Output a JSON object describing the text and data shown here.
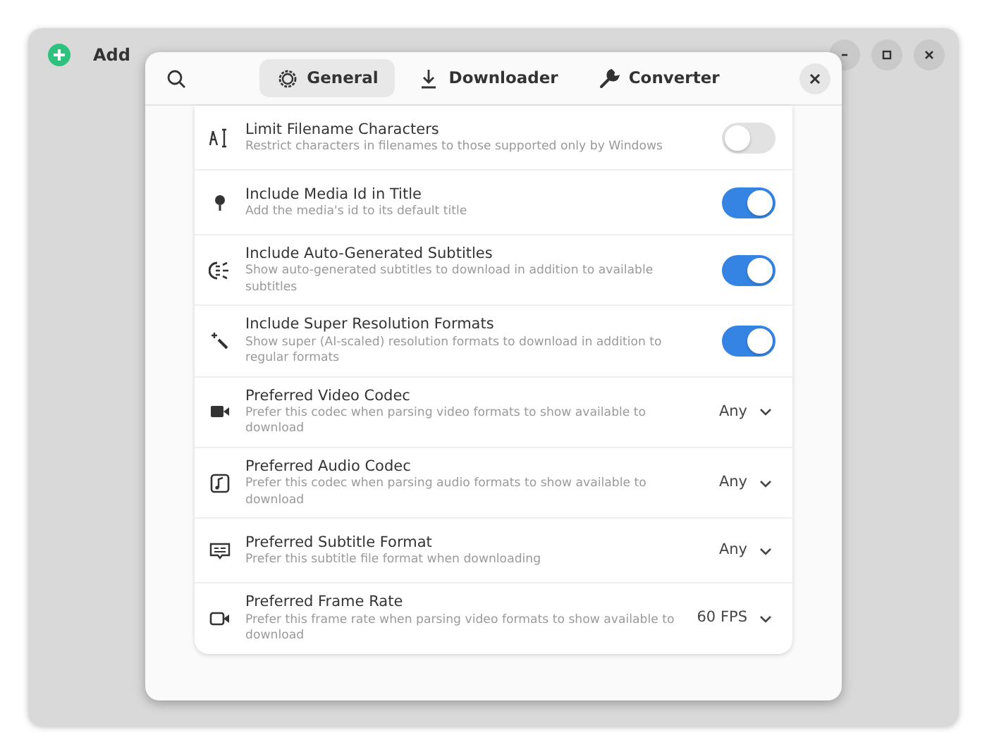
{
  "main_window": {
    "add_button": "Add"
  },
  "dialog": {
    "tabs": [
      {
        "label": "General",
        "selected": true
      },
      {
        "label": "Downloader",
        "selected": false
      },
      {
        "label": "Converter",
        "selected": false
      }
    ],
    "rows": [
      {
        "kind": "switch",
        "title": "Limit Filename Characters",
        "subtitle": "Restrict characters in filenames to those supported only by Windows",
        "on": false
      },
      {
        "kind": "switch",
        "title": "Include Media Id in Title",
        "subtitle": "Add the media's id to its default title",
        "on": true
      },
      {
        "kind": "switch",
        "title": "Include Auto-Generated Subtitles",
        "subtitle": "Show auto-generated subtitles to download in addition to available subtitles",
        "on": true
      },
      {
        "kind": "switch",
        "title": "Include Super Resolution Formats",
        "subtitle": "Show super (AI-scaled) resolution formats to download in addition to regular formats",
        "on": true
      },
      {
        "kind": "dropdown",
        "title": "Preferred Video Codec",
        "subtitle": "Prefer this codec when parsing video formats to show available to download",
        "value": "Any"
      },
      {
        "kind": "dropdown",
        "title": "Preferred Audio Codec",
        "subtitle": "Prefer this codec when parsing audio formats to show available to download",
        "value": "Any"
      },
      {
        "kind": "dropdown",
        "title": "Preferred Subtitle Format",
        "subtitle": "Prefer this subtitle file format when downloading",
        "value": "Any"
      },
      {
        "kind": "dropdown",
        "title": "Preferred Frame Rate",
        "subtitle": "Prefer this frame rate when parsing video formats to show available to download",
        "value": "60 FPS"
      }
    ]
  }
}
